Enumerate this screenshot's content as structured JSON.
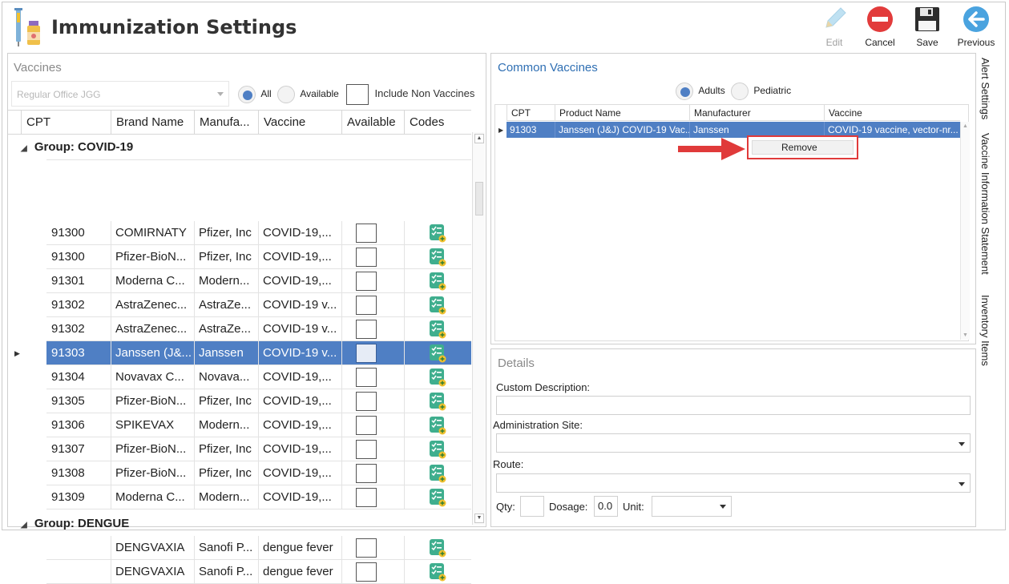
{
  "header": {
    "title": "Immunization Settings",
    "toolbar": {
      "edit": "Edit",
      "cancel": "Cancel",
      "save": "Save",
      "previous": "Previous"
    }
  },
  "vaccines": {
    "title": "Vaccines",
    "office_combo": "Regular Office JGG",
    "filter": {
      "all": "All",
      "available": "Available",
      "include_non_vaccines": "Include Non Vaccines",
      "selected": "All"
    },
    "columns": [
      "CPT",
      "Brand Name",
      "Manufa...",
      "Vaccine",
      "Available",
      "Codes"
    ],
    "groups": [
      {
        "label": "Group: COVID-19",
        "rows": [
          {
            "cpt": "91300",
            "brand": "COMIRNATY",
            "mfr": "Pfizer, Inc",
            "vaccine": "COVID-19,..."
          },
          {
            "cpt": "91300",
            "brand": "Pfizer-BioN...",
            "mfr": "Pfizer, Inc",
            "vaccine": "COVID-19,..."
          },
          {
            "cpt": "91301",
            "brand": "Moderna C...",
            "mfr": "Modern...",
            "vaccine": "COVID-19,..."
          },
          {
            "cpt": "91302",
            "brand": "AstraZenec...",
            "mfr": "AstraZe...",
            "vaccine": "COVID-19 v..."
          },
          {
            "cpt": "91302",
            "brand": "AstraZenec...",
            "mfr": "AstraZe...",
            "vaccine": "COVID-19 v..."
          },
          {
            "cpt": "91303",
            "brand": "Janssen (J&...",
            "mfr": "Janssen",
            "vaccine": "COVID-19 v...",
            "selected": true
          },
          {
            "cpt": "91304",
            "brand": "Novavax C...",
            "mfr": "Novava...",
            "vaccine": "COVID-19,..."
          },
          {
            "cpt": "91305",
            "brand": "Pfizer-BioN...",
            "mfr": "Pfizer, Inc",
            "vaccine": "COVID-19,..."
          },
          {
            "cpt": "91306",
            "brand": "SPIKEVAX",
            "mfr": "Modern...",
            "vaccine": "COVID-19,..."
          },
          {
            "cpt": "91307",
            "brand": "Pfizer-BioN...",
            "mfr": "Pfizer, Inc",
            "vaccine": "COVID-19,..."
          },
          {
            "cpt": "91308",
            "brand": "Pfizer-BioN...",
            "mfr": "Pfizer, Inc",
            "vaccine": "COVID-19,..."
          },
          {
            "cpt": "91309",
            "brand": "Moderna C...",
            "mfr": "Modern...",
            "vaccine": "COVID-19,..."
          }
        ]
      },
      {
        "label": "Group: DENGUE",
        "rows": [
          {
            "cpt": "",
            "brand": "DENGVAXIA",
            "mfr": "Sanofi P...",
            "vaccine": "dengue fever"
          },
          {
            "cpt": "",
            "brand": "DENGVAXIA",
            "mfr": "Sanofi P...",
            "vaccine": "dengue fever"
          }
        ]
      }
    ]
  },
  "common_vaccines": {
    "title": "Common Vaccines",
    "age": {
      "adults": "Adults",
      "pediatric": "Pediatric",
      "selected": "Adults"
    },
    "columns": [
      "CPT",
      "Product Name",
      "Manufacturer",
      "Vaccine"
    ],
    "rows": [
      {
        "cpt": "91303",
        "product": "Janssen (J&J) COVID-19 Vac...",
        "mfr": "Janssen",
        "vaccine": "COVID-19 vaccine, vector-nr..."
      }
    ],
    "context_menu": {
      "remove": "Remove"
    }
  },
  "details": {
    "title": "Details",
    "custom_description_label": "Custom Description:",
    "custom_description_value": "",
    "administration_site_label": "Administration Site:",
    "route_label": "Route:",
    "qty_label": "Qty:",
    "qty_value": "",
    "dosage_label": "Dosage:",
    "dosage_value": "0.0",
    "unit_label": "Unit:"
  },
  "side_tabs": [
    "Alert Settings",
    "Vaccine Information Statement",
    "Inventory Items"
  ],
  "colors": {
    "selection": "#4f7fc4",
    "accent_title": "#2f6fb3",
    "cancel_red": "#e23b3b",
    "previous_blue": "#4aa3df",
    "callout_red": "#e03a3a"
  }
}
